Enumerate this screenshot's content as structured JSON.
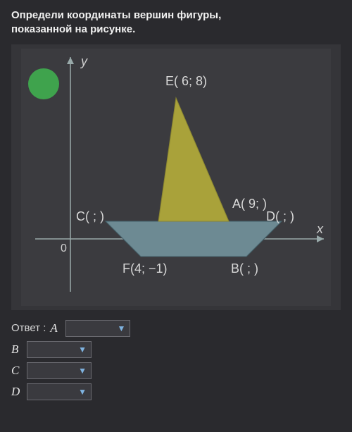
{
  "title_line1": "Определи координаты вершин фигуры,",
  "title_line2": "показанной на рисунке.",
  "axes": {
    "x": "x",
    "y": "y",
    "origin": "0"
  },
  "badge": {
    "text": "",
    "color": "#3fa34d"
  },
  "points": {
    "E": {
      "label": "E( 6; 8)"
    },
    "A": {
      "label": "A( 9;  )"
    },
    "C": {
      "label": "C(  ;  )"
    },
    "D": {
      "label": "D(  ;  )"
    },
    "F": {
      "label": "F(4; −1)"
    },
    "B": {
      "label": "B(  ;  )"
    }
  },
  "answer_prefix": "Ответ :",
  "answers": {
    "A": {
      "label": "A",
      "value": ""
    },
    "B": {
      "label": "B",
      "value": ""
    },
    "C": {
      "label": "C",
      "value": ""
    },
    "D": {
      "label": "D",
      "value": ""
    }
  },
  "chart_data": {
    "type": "scatter",
    "title": "",
    "xlabel": "x",
    "ylabel": "y",
    "xlim": [
      -2,
      14
    ],
    "ylim": [
      -3,
      10
    ],
    "series": [
      {
        "name": "sail",
        "shape": "polygon",
        "fill": "#a9a23a",
        "points": [
          [
            6,
            8
          ],
          [
            9,
            1
          ],
          [
            5,
            1
          ]
        ]
      },
      {
        "name": "hull",
        "shape": "polygon",
        "fill": "#6d8a93",
        "points": [
          [
            2,
            1
          ],
          [
            12,
            1
          ],
          [
            10,
            -1
          ],
          [
            4,
            -1
          ]
        ]
      }
    ],
    "labeled_points": [
      {
        "name": "E",
        "x": 6,
        "y": 8
      },
      {
        "name": "A",
        "x": 9,
        "y": 1
      },
      {
        "name": "C",
        "x": 2,
        "y": 1
      },
      {
        "name": "D",
        "x": 12,
        "y": 1
      },
      {
        "name": "F",
        "x": 4,
        "y": -1
      },
      {
        "name": "B",
        "x": 10,
        "y": -1
      }
    ]
  }
}
